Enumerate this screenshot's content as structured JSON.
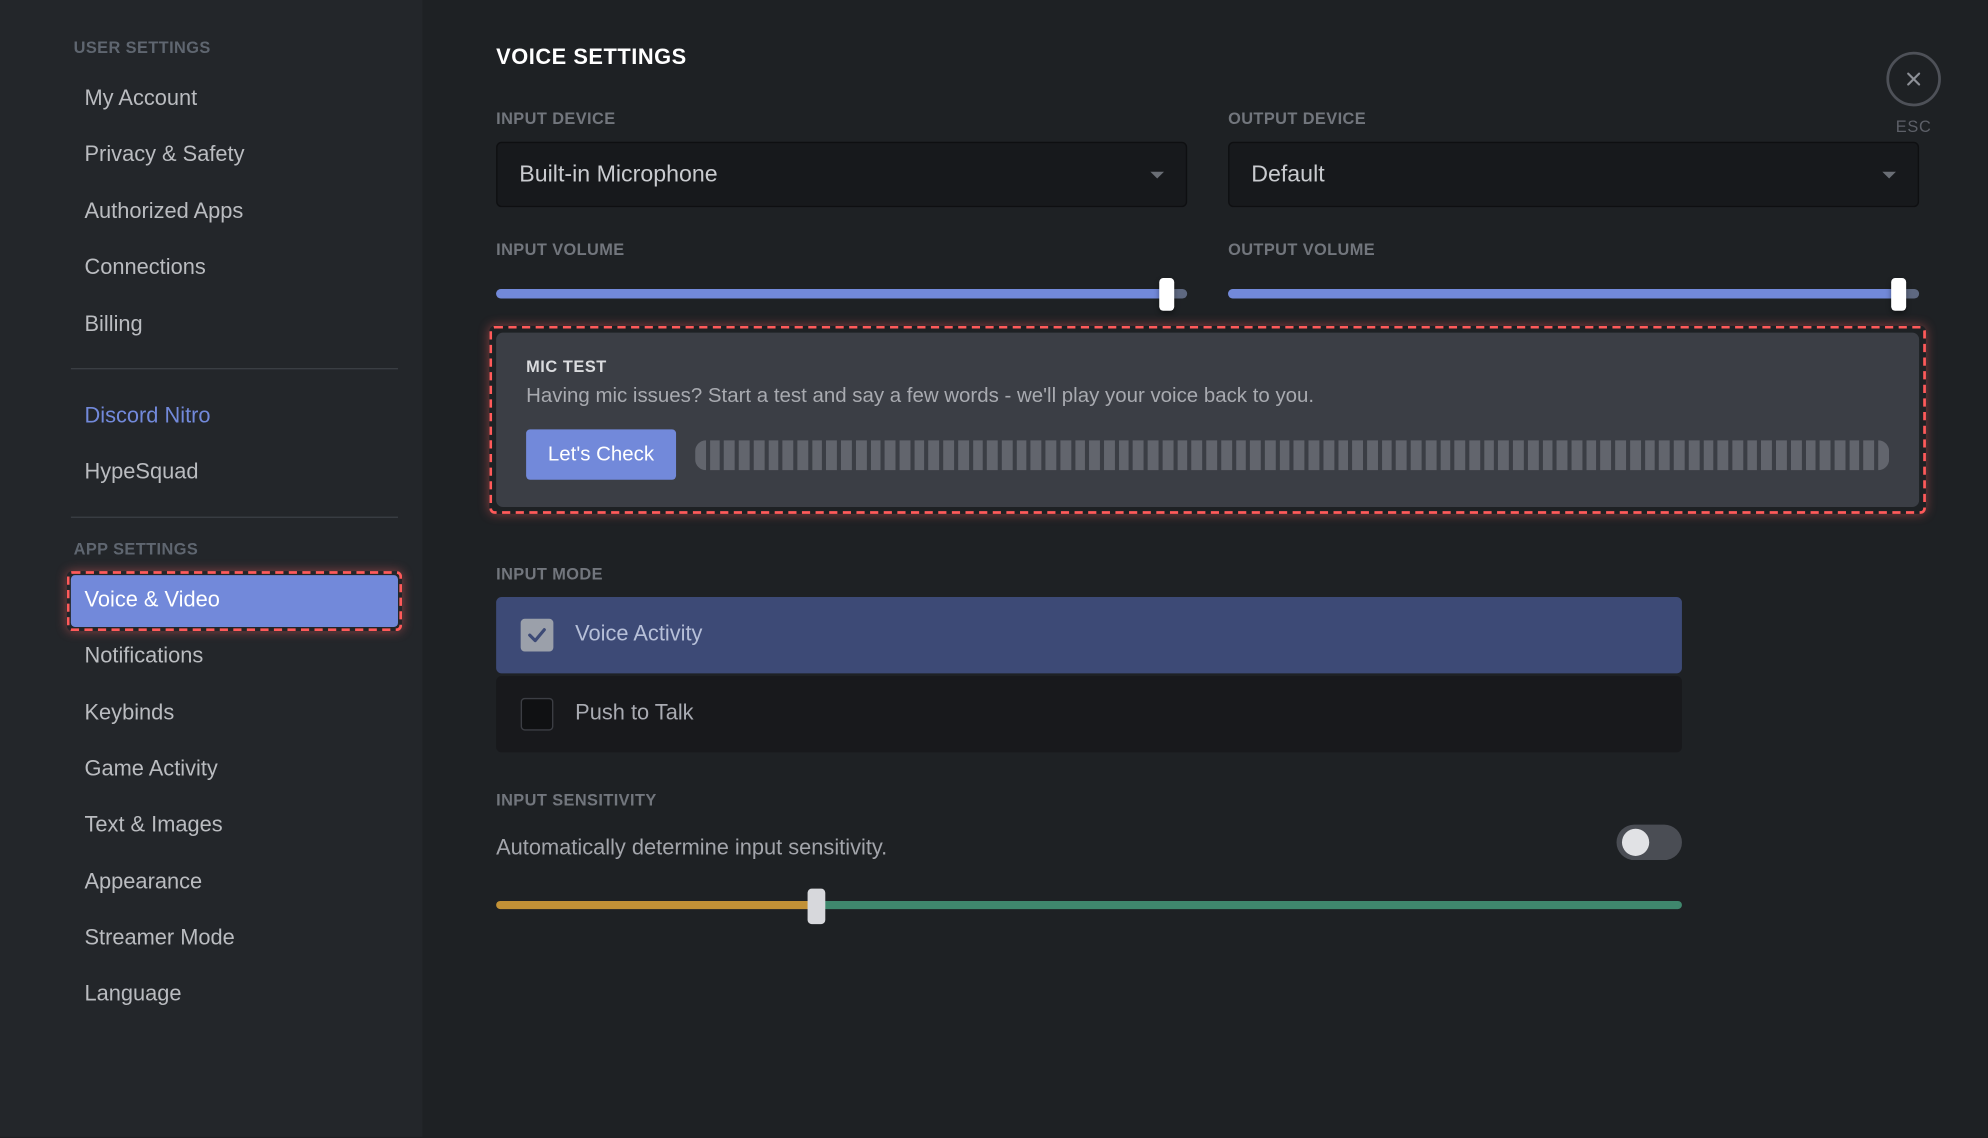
{
  "sidebar": {
    "headings": {
      "user": "USER SETTINGS",
      "app": "APP SETTINGS"
    },
    "user_items": [
      {
        "label": "My Account"
      },
      {
        "label": "Privacy & Safety"
      },
      {
        "label": "Authorized Apps"
      },
      {
        "label": "Connections"
      },
      {
        "label": "Billing"
      }
    ],
    "nitro_items": [
      {
        "label": "Discord Nitro",
        "nitro": true
      },
      {
        "label": "HypeSquad"
      }
    ],
    "app_items": [
      {
        "label": "Voice & Video",
        "active": true,
        "highlight": true
      },
      {
        "label": "Notifications"
      },
      {
        "label": "Keybinds"
      },
      {
        "label": "Game Activity"
      },
      {
        "label": "Text & Images"
      },
      {
        "label": "Appearance"
      },
      {
        "label": "Streamer Mode"
      },
      {
        "label": "Language"
      }
    ]
  },
  "page": {
    "title": "VOICE SETTINGS",
    "input_device_label": "INPUT DEVICE",
    "input_device_value": "Built-in Microphone",
    "output_device_label": "OUTPUT DEVICE",
    "output_device_value": "Default",
    "input_volume_label": "INPUT VOLUME",
    "input_volume_pct": 97,
    "output_volume_label": "OUTPUT VOLUME",
    "output_volume_pct": 97,
    "mic_test": {
      "title": "MIC TEST",
      "desc": "Having mic issues? Start a test and say a few words - we'll play your voice back to you.",
      "button": "Let's Check",
      "meter_segments": 82
    },
    "input_mode": {
      "label": "INPUT MODE",
      "options": [
        {
          "label": "Voice Activity",
          "selected": true
        },
        {
          "label": "Push to Talk",
          "selected": false
        }
      ]
    },
    "sensitivity": {
      "label": "INPUT SENSITIVITY",
      "desc": "Automatically determine input sensitivity.",
      "toggle": false,
      "split_pct": 27
    },
    "close": {
      "esc": "ESC"
    }
  }
}
